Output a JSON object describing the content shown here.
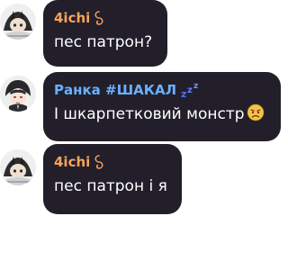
{
  "messages": [
    {
      "author": "4ichi",
      "author_color": "#f7a35c",
      "badge_icon": "infinity-curl-icon",
      "text": "пес патрон?"
    },
    {
      "author": "Ранка #ШАКАЛ",
      "author_color": "#6ab0ff",
      "badge_icon": "sleeping-zzz-icon",
      "text": "І шкарпетковий монстр",
      "trailing_icon": "angry-face-emoji"
    },
    {
      "author": "4ichi",
      "author_color": "#f7a35c",
      "badge_icon": "infinity-curl-icon",
      "text": "пес патрон і я"
    }
  ]
}
